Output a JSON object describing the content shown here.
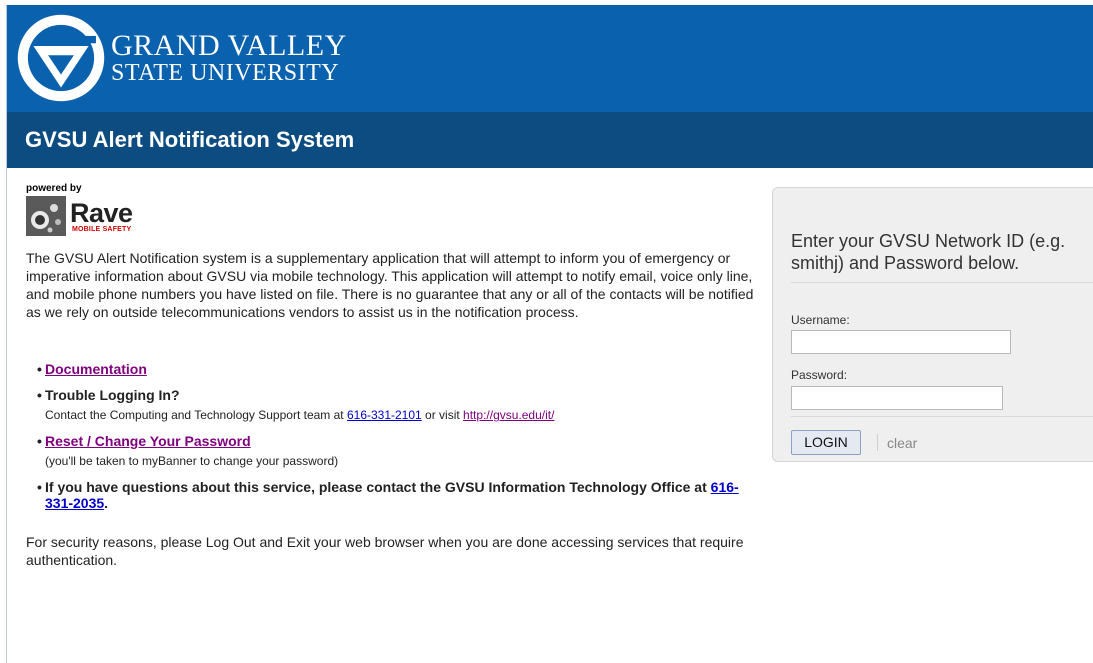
{
  "header": {
    "logo_line1": "GRAND VALLEY",
    "logo_line2": "STATE UNIVERSITY",
    "logo_alt": "Grand Valley State University"
  },
  "titlebar": {
    "title": "GVSU Alert Notification System"
  },
  "powered": {
    "label": "powered by",
    "brand": "Rave",
    "tagline": "MOBILE SAFETY"
  },
  "intro": "The GVSU Alert Notification system is a supplementary application that will attempt to inform you of emergency or imperative information about GVSU via mobile technology. This application will attempt to notify email, voice only line, and mobile phone numbers you have listed on file. There is no guarantee that any or all of the contacts will be notified as we rely on outside telecommunications vendors to assist us in the notification process.",
  "links": {
    "documentation": "Documentation",
    "trouble": {
      "title": "Trouble Logging In?",
      "text_before": "Contact the Computing and Technology Support team at ",
      "phone": "616-331-2101",
      "text_mid": " or visit ",
      "url": "http://gvsu.edu/it/"
    },
    "reset": {
      "title": "Reset / Change Your Password",
      "note": "(you'll be taken to myBanner to change your password)"
    },
    "questions": {
      "text": "If you have questions about this service, please contact the GVSU Information Technology Office at ",
      "phone": "616-331-2035",
      "end": "."
    }
  },
  "footer": "For security reasons, please Log Out and Exit your web browser when you are done accessing services that require authentication.",
  "login": {
    "prompt": "Enter your GVSU Network ID (e.g. smithj) and Password below.",
    "username_label": "Username:",
    "username_value": "",
    "password_label": "Password:",
    "password_value": "",
    "login_button": "LOGIN",
    "clear": "clear"
  },
  "colors": {
    "header_blue": "#0a62ae",
    "titlebar_blue": "#0d4c80",
    "link_purple": "#800080",
    "link_blue": "#0000cc"
  }
}
